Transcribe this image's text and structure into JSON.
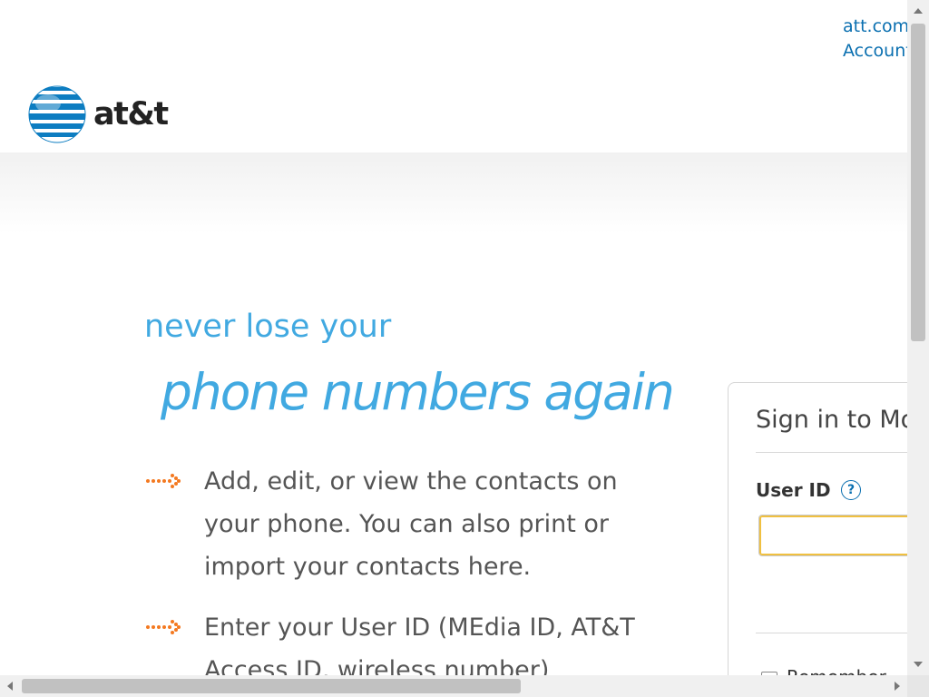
{
  "header": {
    "links": [
      "att.com",
      "Account"
    ],
    "logo_text": "at&t"
  },
  "hero": {
    "headline_line1": "never lose your",
    "headline_line2": "phone numbers again",
    "bullets": [
      "Add, edit, or view the contacts on your phone. You can also print or import your contacts here.",
      "Enter your User ID (MEdia ID, AT&T Access ID, wireless number)"
    ]
  },
  "signin": {
    "title": "Sign in to Mo",
    "userid_label": "User ID",
    "help_icon_glyph": "?",
    "userid_value": "",
    "remember_label": "Remember"
  },
  "colors": {
    "accent_blue": "#41a9e1",
    "link_blue": "#0a6fb0",
    "arrow_orange": "#f47920"
  }
}
